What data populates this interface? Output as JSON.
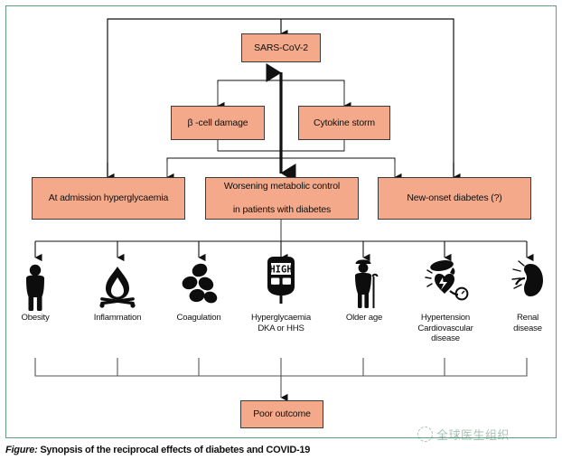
{
  "figure": {
    "caption_lead": "Figure:",
    "caption_text": " Synopsis of the reciprocal effects of diabetes and COVID-19",
    "frame_color": "#5f9e7e",
    "box_fill": "#f4a98a",
    "box_stroke": "#3a3a3a",
    "line_color": "#1a1a1a"
  },
  "nodes": {
    "virus": {
      "label": "SARS-CoV-2"
    },
    "beta_cell": {
      "label": "β -cell damage"
    },
    "cytokine": {
      "label": "Cytokine storm"
    },
    "admission": {
      "label": "At admission hyperglycaemia"
    },
    "worsening": {
      "line1": "Worsening metabolic control",
      "line2": "in patients with diabetes"
    },
    "new_onset": {
      "label": "New-onset diabetes (?)"
    },
    "outcome": {
      "label": "Poor outcome"
    }
  },
  "risk_factors": [
    {
      "icon": "obese-person-icon",
      "line1": "Obesity",
      "line2": "",
      "line3": ""
    },
    {
      "icon": "campfire-flame-icon",
      "line1": "Inflammation",
      "line2": "",
      "line3": ""
    },
    {
      "icon": "blood-cells-icon",
      "line1": "Coagulation",
      "line2": "",
      "line3": ""
    },
    {
      "icon": "glucose-meter-high-icon",
      "line1": "Hyperglycaemia",
      "line2": "DKA or HHS",
      "line3": ""
    },
    {
      "icon": "older-person-cane-icon",
      "line1": "Older age",
      "line2": "",
      "line3": ""
    },
    {
      "icon": "heart-blood-pressure-icon",
      "line1": "Hypertension",
      "line2": "Cardiovascular",
      "line3": "disease"
    },
    {
      "icon": "kidney-icon",
      "line1": "Renal",
      "line2": "disease",
      "line3": ""
    }
  ],
  "meter_display": "HIGH",
  "watermark": {
    "text": "全球医生组织"
  }
}
